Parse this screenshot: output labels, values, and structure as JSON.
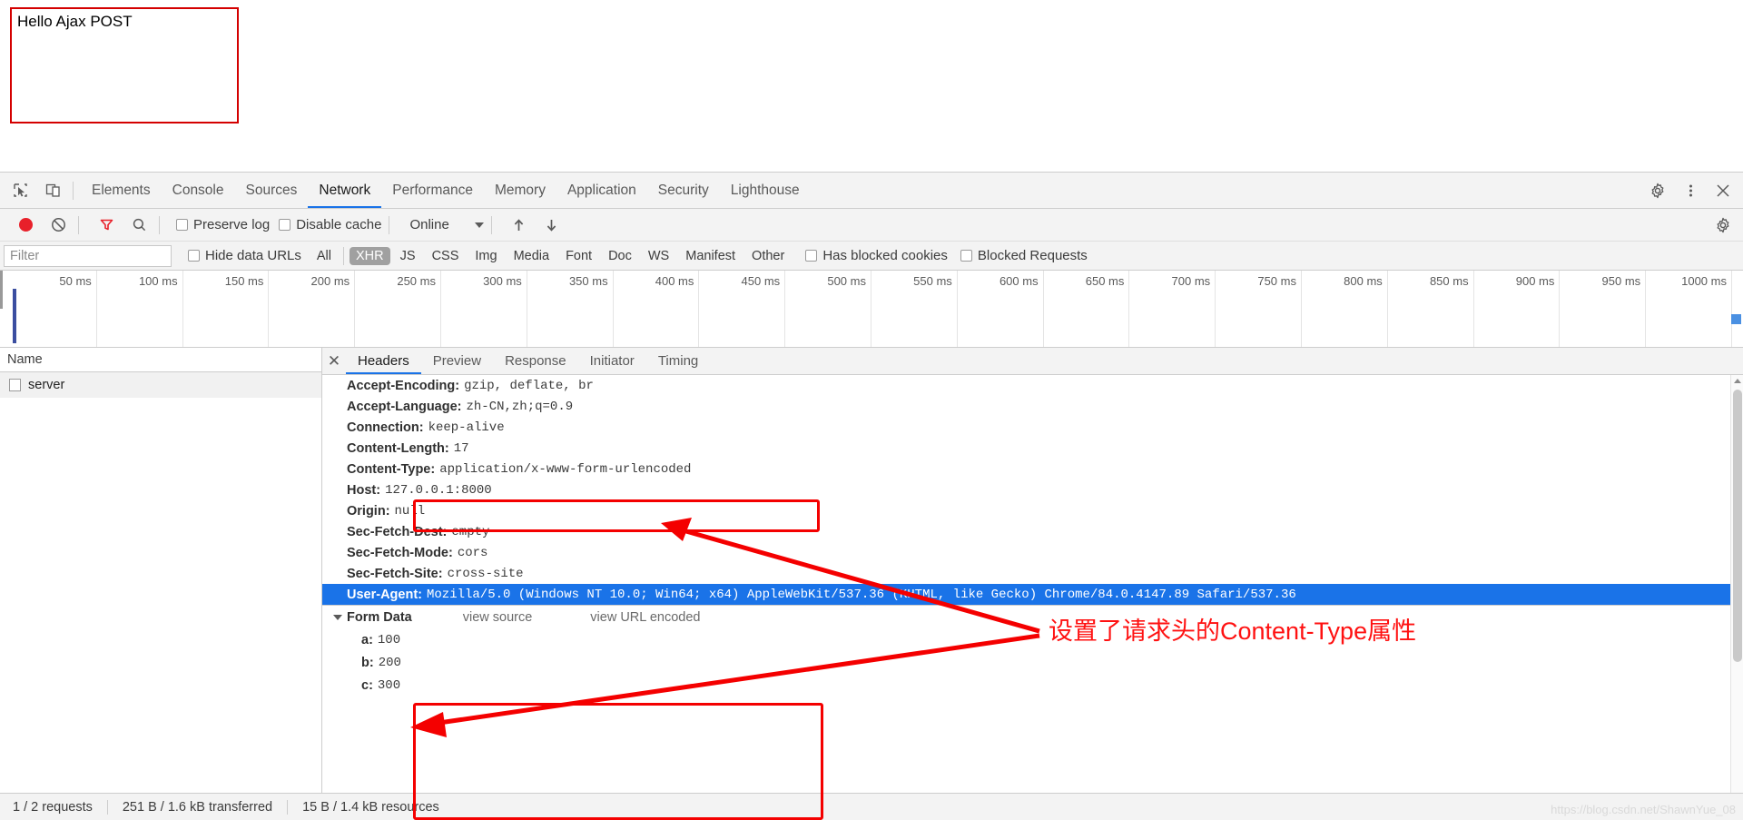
{
  "page": {
    "hello_text": "Hello Ajax POST"
  },
  "devtools": {
    "icons": {
      "inspect": "inspect-element-icon",
      "device": "device-toolbar-icon",
      "settings": "gear-icon",
      "more": "more-options-icon",
      "close": "close-icon"
    },
    "tabs": [
      {
        "label": "Elements",
        "active": false
      },
      {
        "label": "Console",
        "active": false
      },
      {
        "label": "Sources",
        "active": false
      },
      {
        "label": "Network",
        "active": true
      },
      {
        "label": "Performance",
        "active": false
      },
      {
        "label": "Memory",
        "active": false
      },
      {
        "label": "Application",
        "active": false
      },
      {
        "label": "Security",
        "active": false
      },
      {
        "label": "Lighthouse",
        "active": false
      }
    ]
  },
  "network_toolbar": {
    "record_title": "record-button",
    "clear_title": "clear-button",
    "filter_title": "filter-funnel-icon",
    "search_title": "search-icon",
    "preserve_log": "Preserve log",
    "disable_cache": "Disable cache",
    "throttle": "Online",
    "import_title": "import-har-icon",
    "export_title": "export-har-icon",
    "settings_title": "network-settings-gear-icon"
  },
  "filter_bar": {
    "placeholder": "Filter",
    "value": "",
    "hide_data_urls": "Hide data URLs",
    "types": [
      {
        "label": "All",
        "selected": false
      },
      {
        "label": "XHR",
        "selected": true
      },
      {
        "label": "JS",
        "selected": false
      },
      {
        "label": "CSS",
        "selected": false
      },
      {
        "label": "Img",
        "selected": false
      },
      {
        "label": "Media",
        "selected": false
      },
      {
        "label": "Font",
        "selected": false
      },
      {
        "label": "Doc",
        "selected": false
      },
      {
        "label": "WS",
        "selected": false
      },
      {
        "label": "Manifest",
        "selected": false
      },
      {
        "label": "Other",
        "selected": false
      }
    ],
    "has_blocked_cookies": "Has blocked cookies",
    "blocked_requests": "Blocked Requests"
  },
  "timeline": {
    "ticks": [
      "50 ms",
      "100 ms",
      "150 ms",
      "200 ms",
      "250 ms",
      "300 ms",
      "350 ms",
      "400 ms",
      "450 ms",
      "500 ms",
      "550 ms",
      "600 ms",
      "650 ms",
      "700 ms",
      "750 ms",
      "800 ms",
      "850 ms",
      "900 ms",
      "950 ms",
      "1000 ms"
    ]
  },
  "request_list": {
    "column_header": "Name",
    "rows": [
      {
        "name": "server"
      }
    ]
  },
  "details": {
    "tabs": [
      {
        "label": "Headers",
        "active": true
      },
      {
        "label": "Preview",
        "active": false
      },
      {
        "label": "Response",
        "active": false
      },
      {
        "label": "Initiator",
        "active": false
      },
      {
        "label": "Timing",
        "active": false
      }
    ],
    "headers": [
      {
        "key": "Accept-Encoding:",
        "value": "gzip, deflate, br",
        "selected": false
      },
      {
        "key": "Accept-Language:",
        "value": "zh-CN,zh;q=0.9",
        "selected": false
      },
      {
        "key": "Connection:",
        "value": "keep-alive",
        "selected": false
      },
      {
        "key": "Content-Length:",
        "value": "17",
        "selected": false
      },
      {
        "key": "Content-Type:",
        "value": "application/x-www-form-urlencoded",
        "selected": false
      },
      {
        "key": "Host:",
        "value": "127.0.0.1:8000",
        "selected": false
      },
      {
        "key": "Origin:",
        "value": "null",
        "selected": false
      },
      {
        "key": "Sec-Fetch-Dest:",
        "value": "empty",
        "selected": false
      },
      {
        "key": "Sec-Fetch-Mode:",
        "value": "cors",
        "selected": false
      },
      {
        "key": "Sec-Fetch-Site:",
        "value": "cross-site",
        "selected": false
      },
      {
        "key": "User-Agent:",
        "value": "Mozilla/5.0 (Windows NT 10.0; Win64; x64) AppleWebKit/537.36 (KHTML, like Gecko) Chrome/84.0.4147.89 Safari/537.36",
        "selected": true
      }
    ],
    "form_data": {
      "title": "Form Data",
      "view_source": "view source",
      "view_url_encoded": "view URL encoded",
      "entries": [
        {
          "key": "a:",
          "value": "100"
        },
        {
          "key": "b:",
          "value": "200"
        },
        {
          "key": "c:",
          "value": "300"
        }
      ]
    }
  },
  "status_bar": {
    "requests": "1 / 2 requests",
    "transferred": "251 B / 1.6 kB transferred",
    "resources": "15 B / 1.4 kB resources"
  },
  "annotations": {
    "note": "设置了请求头的Content-Type属性",
    "color": "#ff1111",
    "watermark": "https://blog.csdn.net/ShawnYue_08"
  }
}
